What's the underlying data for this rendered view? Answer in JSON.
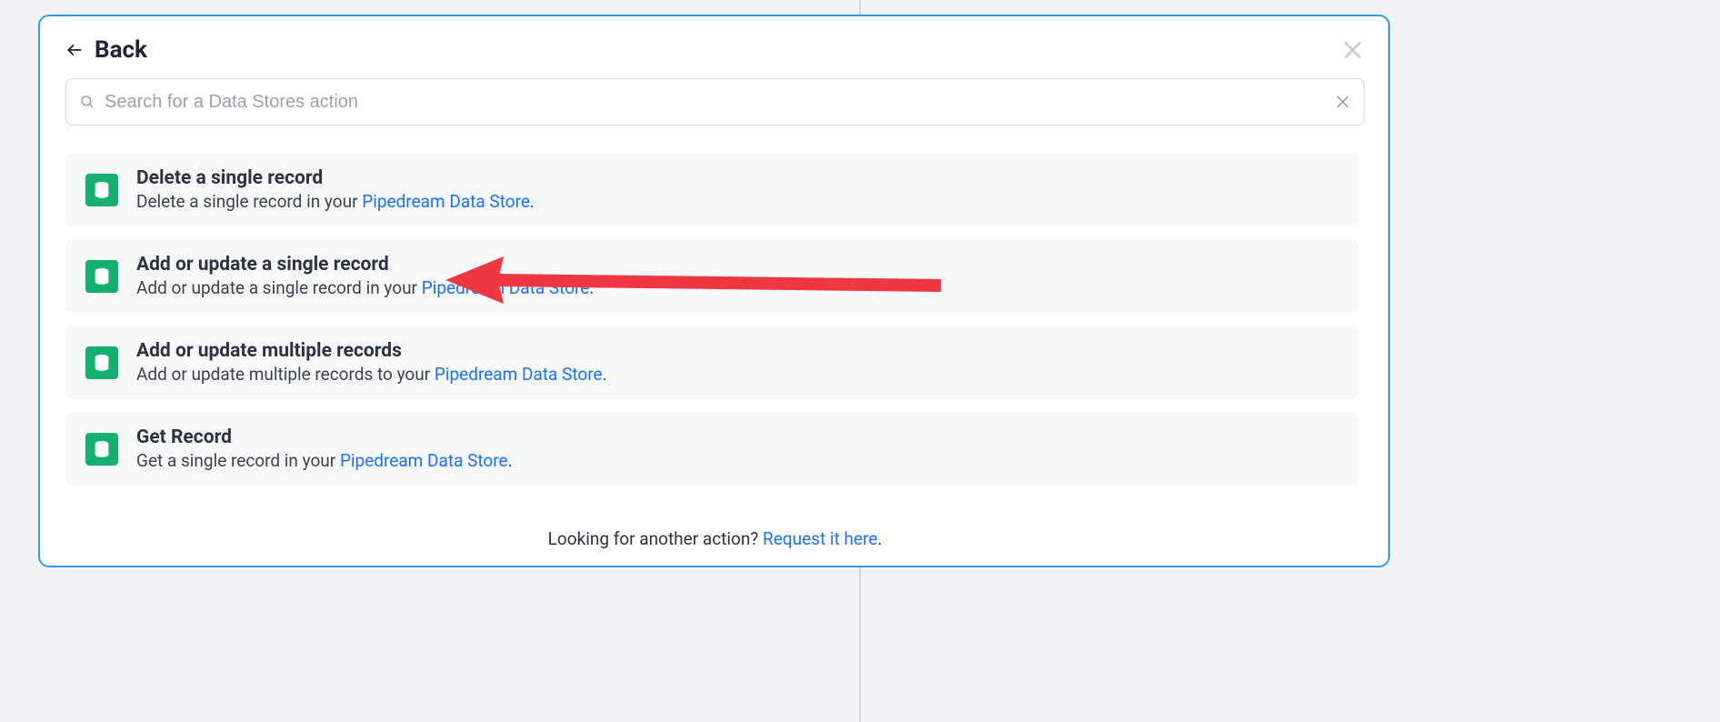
{
  "header": {
    "back_label": "Back"
  },
  "search": {
    "placeholder": "Search for a Data Stores action"
  },
  "link_text": "Pipedream Data Store",
  "actions": [
    {
      "title": "Delete a single record",
      "desc_prefix": "Delete a single record in your ",
      "desc_suffix": "."
    },
    {
      "title": "Add or update a single record",
      "desc_prefix": "Add or update a single record in your ",
      "desc_suffix": "."
    },
    {
      "title": "Add or update multiple records",
      "desc_prefix": "Add or update multiple records to your ",
      "desc_suffix": "."
    },
    {
      "title": "Get Record",
      "desc_prefix": "Get a single record in your ",
      "desc_suffix": "."
    }
  ],
  "footer": {
    "prompt": "Looking for another action? ",
    "link": "Request it here",
    "suffix": "."
  }
}
